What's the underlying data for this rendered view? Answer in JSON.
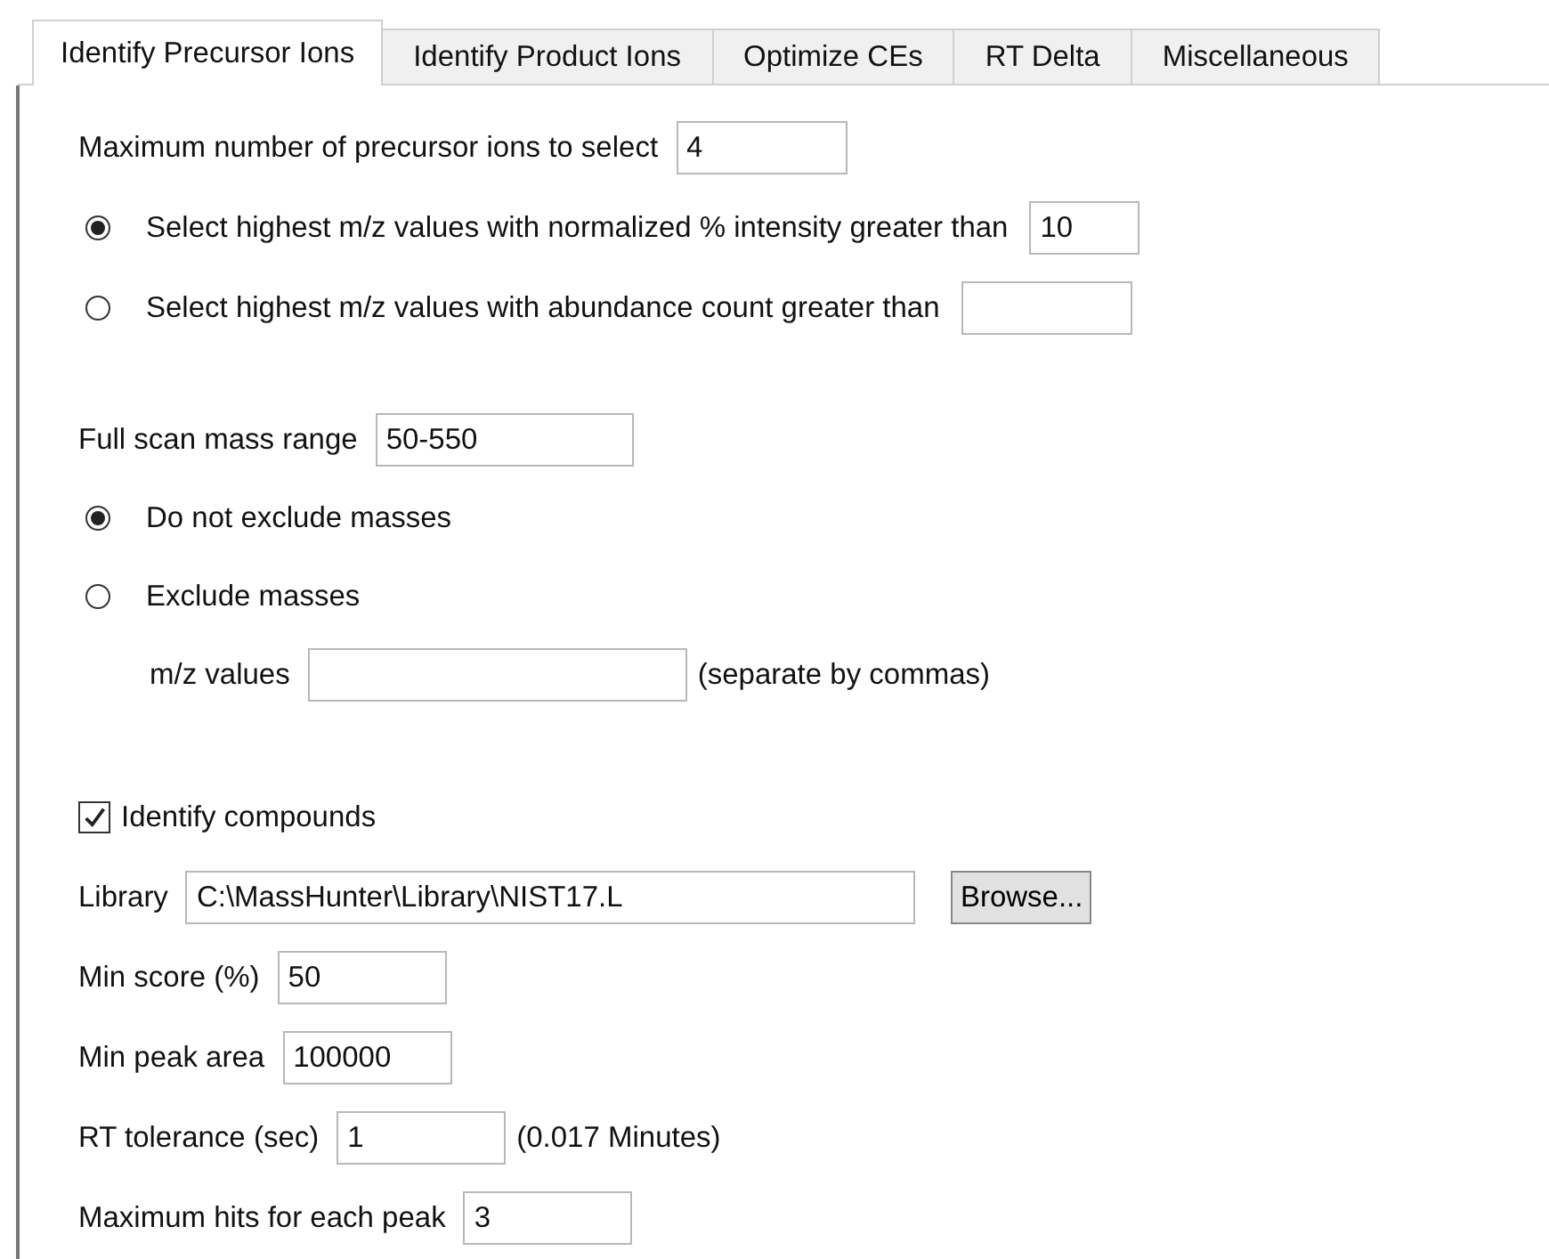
{
  "tabs": [
    {
      "label": "Identify Precursor Ions",
      "selected": true
    },
    {
      "label": "Identify Product Ions",
      "selected": false
    },
    {
      "label": "Optimize CEs",
      "selected": false
    },
    {
      "label": "RT Delta",
      "selected": false
    },
    {
      "label": "Miscellaneous",
      "selected": false
    }
  ],
  "sections": [
    {
      "rows": [
        {
          "kind": "field",
          "label": "Maximum number of precursor ions to select",
          "value": "4"
        },
        {
          "kind": "radio",
          "label": "Select highest m/z values with normalized % intensity greater than",
          "selected": true,
          "value": "10"
        },
        {
          "kind": "radio",
          "label": "Select highest m/z values with abundance count greater than",
          "selected": false,
          "value": ""
        }
      ]
    },
    {
      "rows": [
        {
          "kind": "field",
          "label": "Full scan mass range",
          "value": "50-550"
        },
        {
          "kind": "radio",
          "label": "Do not exclude masses",
          "selected": true
        },
        {
          "kind": "radio",
          "label": "Exclude masses",
          "selected": false
        },
        {
          "kind": "subfield",
          "label": "m/z values",
          "value": "",
          "suffix": "(separate by commas)"
        }
      ]
    },
    {
      "rows": [
        {
          "kind": "checkbox",
          "label": "Identify compounds",
          "checked": true
        },
        {
          "kind": "field",
          "label": "Library",
          "value": "C:\\MassHunter\\Library\\NIST17.L",
          "button": "Browse..."
        },
        {
          "kind": "field",
          "label": "Min score (%)",
          "value": "50"
        },
        {
          "kind": "field",
          "label": "Min peak area",
          "value": "100000"
        },
        {
          "kind": "field",
          "label": "RT tolerance (sec)",
          "value": "1",
          "suffix": "(0.017 Minutes)"
        },
        {
          "kind": "field",
          "label": "Maximum hits for each peak",
          "value": "3"
        }
      ]
    }
  ]
}
